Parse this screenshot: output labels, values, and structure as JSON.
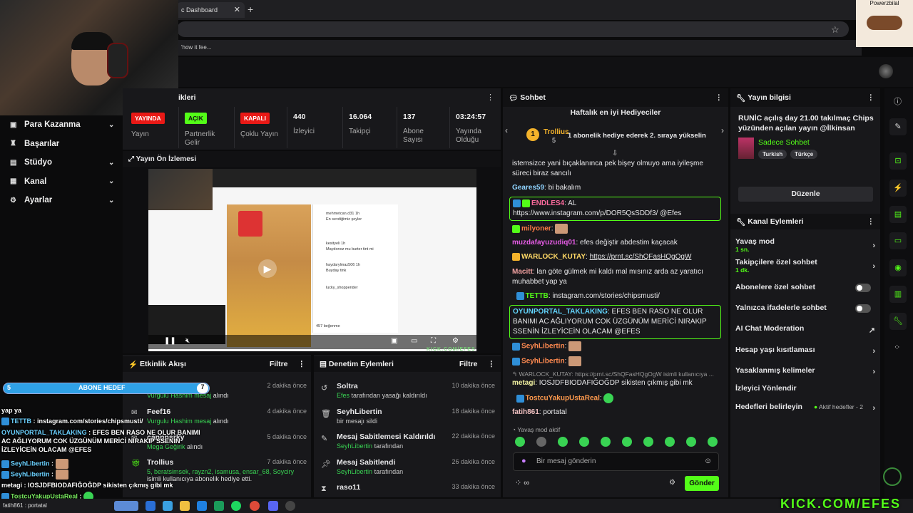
{
  "browser": {
    "tab_title": "c Dashboard",
    "bookmark": "'how it fee...",
    "cam_right_label": "Powerzbilal"
  },
  "sidebar": {
    "items": [
      {
        "label": "Para Kazanma",
        "icon": "dollar-icon",
        "has_chevron": true
      },
      {
        "label": "Başarılar",
        "icon": "trophy-icon",
        "has_chevron": false
      },
      {
        "label": "Stüdyo",
        "icon": "studio-icon",
        "has_chevron": true
      },
      {
        "label": "Kanal",
        "icon": "channel-icon",
        "has_chevron": true
      },
      {
        "label": "Ayarlar",
        "icon": "gear-icon",
        "has_chevron": true
      }
    ]
  },
  "stats": {
    "header": "ikleri",
    "items": [
      {
        "value": "YAYINDA",
        "label": "Yayın",
        "badge_color": "#e91916"
      },
      {
        "value": "AÇIK",
        "label": "Partnerlik Gelir",
        "badge_color": "#53fc18"
      },
      {
        "value": "KAPALI",
        "label": "Çoklu Yayın",
        "badge_color": "#e91916"
      },
      {
        "value": "440",
        "label": "İzleyici"
      },
      {
        "value": "16.064",
        "label": "Takipçi"
      },
      {
        "value": "137",
        "label": "Abone Sayısı"
      },
      {
        "value": "03:24:57",
        "label": "Yayında Olduğu"
      }
    ]
  },
  "preview": {
    "title": "Yayın Ön İzlemesi",
    "feed_lines": [
      "mehmetcan.d31 1h",
      "En sevdiğimiz şeyler",
      "kesityeli 1h",
      "Maydonoz mu burter tint mi",
      "haydarylmaz506 1h",
      "Buyday tink",
      "lucky_shopperider",
      "457 beğenme"
    ],
    "watermark": "KICK.COM/EFES"
  },
  "events": {
    "title": "Etkinlik Akışı",
    "filter": "Filtre",
    "items": [
      {
        "name": "Feef16",
        "desc_green": "Vurgulu Hashim mesaj",
        "desc_white": "alındı",
        "time": "2 dakika önce"
      },
      {
        "name": "Feef16",
        "desc_green": "Vurgulu Hashim mesaj",
        "desc_white": "alındı",
        "time": "4 dakika önce"
      },
      {
        "name": "cannnsrky",
        "desc_green": "Mega Geğirik",
        "desc_white": "alındı",
        "time": "5 dakika önce"
      },
      {
        "name": "Trollius",
        "desc_green": "5, beratsimsek, rayzn2, isamusa, ensar_68, Soyciry",
        "desc_white": "isimli kullanıcıya abonelik hediye etti.",
        "time": "7 dakika önce"
      }
    ]
  },
  "mod_actions": {
    "title": "Denetim Eylemleri",
    "filter": "Filtre",
    "items": [
      {
        "name": "Soltra",
        "desc_green": "Efes",
        "desc_white": "tarafından yasağı kaldırıldı",
        "time": "10 dakika önce",
        "icon": "unban-icon"
      },
      {
        "name": "SeyhLibertin",
        "desc_green": "",
        "desc_white": "bir mesajı sildi",
        "time": "18 dakika önce",
        "icon": "trash-icon"
      },
      {
        "name": "Mesaj Sabitlemesi Kaldırıldı",
        "desc_green": "SeyhLibertin",
        "desc_white": "tarafından",
        "time": "22 dakika önce",
        "icon": "unpin-icon"
      },
      {
        "name": "Mesaj Sabitlendi",
        "desc_green": "SeyhLibertin",
        "desc_white": "tarafından",
        "time": "26 dakika önce",
        "icon": "pin-icon"
      },
      {
        "name": "raso11",
        "desc_green": "",
        "desc_white": "",
        "time": "33 dakika önce",
        "icon": "hourglass-icon"
      }
    ]
  },
  "overlay": {
    "sub_goal_count": "5",
    "sub_goal_label": "ABONE HEDEF",
    "sub_goal_target": "7",
    "lines": [
      {
        "user": "",
        "text": "yap ya",
        "color": "white"
      },
      {
        "user": "TETTB",
        "text": "instagram.com/stories/chipsmusti/",
        "color": "blue"
      },
      {
        "user": "OYUNPORTAL_TAKLAKING",
        "text": "EFES BEN RASO NE OLUR BANIMI AC AĞLIYORUM COK ÜZGÜNÜM MERİCİ NIRAKIP SSENİN İZLEYİCEİN OLACAM @EFES",
        "color": "blue"
      },
      {
        "user": "SeyhLibertin",
        "text": "",
        "color": "blue"
      },
      {
        "user": "SeyhLibertin",
        "text": "",
        "color": "blue"
      },
      {
        "user": "metagi",
        "text": "IOSJDFBIODAFIĞOĞDP sikisten çıkmış gibi mk",
        "color": "white"
      },
      {
        "user": "TostcuYakupUstaReal",
        "text": "",
        "color": "green"
      },
      {
        "user": "fatih861",
        "text": "portatal",
        "color": "white"
      }
    ]
  },
  "chat": {
    "title": "Sohbet",
    "gifter_title": "Haftalık en iyi Hediyeciler",
    "gifter_rank": "1",
    "gifter_name": "Trollius",
    "gifter_count": "5",
    "gifter_note": "1 abonelik hediye ederek 2. sıraya yükselin",
    "messages": [
      {
        "user": "",
        "text": "istemsizce yani bıçaklanınca pek bişey olmuyo ama iyileşme süreci biraz sancılı",
        "ucolor": "#e8e8ea"
      },
      {
        "user": "Geares59",
        "text": "bi bakalım",
        "ucolor": "#8fd3ff"
      },
      {
        "user": "ENDLES4",
        "text": "AL https://www.instagram.com/p/DOR5QsSDDf3/ @Efes",
        "ucolor": "#ff6b9e"
      },
      {
        "user": "milyoner",
        "text": "",
        "ucolor": "#ff7a45"
      },
      {
        "user": "muzdafayuzudiq01",
        "text": "efes değiştir abdestim kaçacak",
        "ucolor": "#e65ce6"
      },
      {
        "user": "WARLOCK_KUTAY",
        "text": "https://prnt.sc/ShQFasHQgOgW",
        "ucolor": "#ffd966"
      },
      {
        "user": "Macitt",
        "text": "lan göte gülmek mi kaldı mal mısınız arda az yaratıcı muhabbet yap ya",
        "ucolor": "#f0a0a0"
      },
      {
        "user": "TETTB",
        "text": "instagram.com/stories/chipsmusti/",
        "ucolor": "#53fc18"
      },
      {
        "user": "OYUNPORTAL_TAKLAKING",
        "text": "EFES BEN RASO NE OLUR BANIMI AC AĞLIYORUM COK ÜZGÜNÜM MERİCİ NIRAKIP SSENİN İZLEYİCEİN OLACAM @EFES",
        "ucolor": "#63d6ff"
      },
      {
        "user": "SeyhLibertin",
        "text": "",
        "ucolor": "#ff8a50"
      },
      {
        "user": "SeyhLibertin",
        "text": "",
        "ucolor": "#ff8a50"
      },
      {
        "user": "",
        "text": "↰ WARLOCK_KUTAY: https://prnt.sc/ShQFasHQgOgW isimli kullanıcıya ...",
        "ucolor": "#999"
      },
      {
        "user": "metagi",
        "text": "IOSJDFBIODAFIĞOĞDP sikisten çıkmış gibi mk",
        "ucolor": "#f0f0a0"
      },
      {
        "user": "TostcuYakupUstaReal",
        "text": "",
        "ucolor": "#ff9a4d"
      },
      {
        "user": "fatih861",
        "text": "portatal",
        "ucolor": "#f0c0c0"
      }
    ],
    "slow_mode_note": "Yavaş mod aktif",
    "input_placeholder": "Bir mesaj gönderin",
    "send_label": "Gönder"
  },
  "info": {
    "title": "Yayın bilgisi",
    "stream_title": "RUNİC açılış day 21.00 takılmaç Chips yüzünden açılan yayın @İlkinsan",
    "category": "Sadece Sohbet",
    "tags": [
      "Turkish",
      "Türkçe"
    ],
    "edit_label": "Düzenle"
  },
  "channel_actions": {
    "title": "Kanal Eylemleri",
    "items": [
      {
        "label": "Yavaş mod",
        "sub": "1 sn.",
        "end": "chevron"
      },
      {
        "label": "Takipçilere özel sohbet",
        "sub": "1 dk.",
        "end": "chevron"
      },
      {
        "label": "Abonelere özel sohbet",
        "sub": "",
        "end": "toggle"
      },
      {
        "label": "Yalnızca ifadelerle sohbet",
        "sub": "",
        "end": "toggle"
      },
      {
        "label": "AI Chat Moderation",
        "sub": "",
        "end": "external"
      },
      {
        "label": "Hesap yaşı kısıtlaması",
        "sub": "",
        "end": "chevron"
      },
      {
        "label": "Yasaklanmış kelimeler",
        "sub": "",
        "end": "chevron"
      },
      {
        "label": "İzleyici Yönlendir",
        "sub": "",
        "end": "none"
      },
      {
        "label": "Hedefleri belirleyin",
        "sub": "",
        "end": "chevron",
        "extra": "Aktif hedefler - 2"
      }
    ]
  },
  "taskbar": {
    "left_text": "fatih861 : portatal",
    "watermark": "KICK.COM/EFES"
  },
  "colors": {
    "accent": "#53fc18",
    "live": "#e91916",
    "panel": "#18181b"
  }
}
